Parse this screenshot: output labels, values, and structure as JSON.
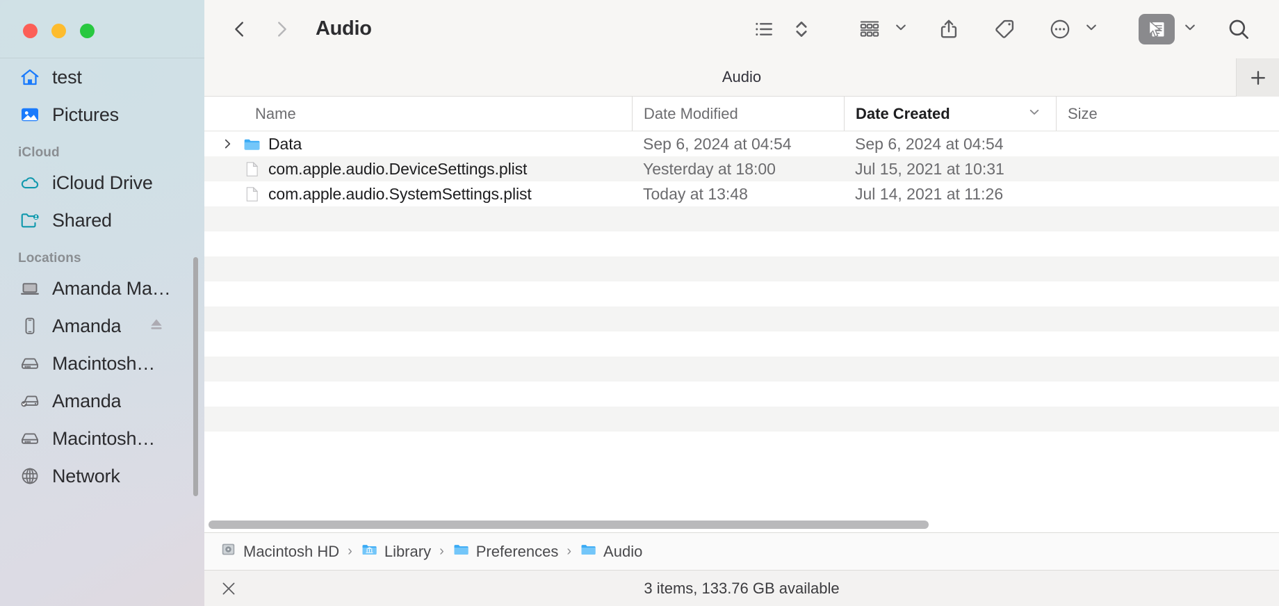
{
  "window": {
    "title": "Audio",
    "subtitle": "Audio",
    "traffic_lights": [
      {
        "name": "close",
        "color": "#fc5f57"
      },
      {
        "name": "minimize",
        "color": "#fdbc2e"
      },
      {
        "name": "zoom",
        "color": "#28c840"
      }
    ]
  },
  "toolbar": {
    "back_label": "Back",
    "forward_label": "Forward",
    "items": [
      {
        "name": "list-view-icon",
        "label": "List View"
      },
      {
        "name": "sort-icon",
        "label": "Sort"
      },
      {
        "name": "group-view-icon",
        "label": "Group"
      },
      {
        "name": "share-icon",
        "label": "Share"
      },
      {
        "name": "tag-icon",
        "label": "Tags"
      },
      {
        "name": "more-icon",
        "label": "More"
      },
      {
        "name": "quick-actions-icon",
        "label": "Quick Actions"
      },
      {
        "name": "search-icon",
        "label": "Search"
      }
    ],
    "add_tab_label": "+"
  },
  "sidebar": {
    "favorites": [
      {
        "label": "test",
        "icon": "home-icon",
        "color": "#1a7bfc"
      },
      {
        "label": "Pictures",
        "icon": "pictures-icon",
        "color": "#1a7bfc"
      }
    ],
    "icloud_title": "iCloud",
    "icloud": [
      {
        "label": "iCloud Drive",
        "icon": "cloud-icon",
        "color": "#1098ad"
      },
      {
        "label": "Shared",
        "icon": "shared-folder-icon",
        "color": "#1098ad"
      }
    ],
    "locations_title": "Locations",
    "locations": [
      {
        "label": "Amanda Ma…",
        "icon": "laptop-icon",
        "eject": false
      },
      {
        "label": "Amanda",
        "icon": "iphone-icon",
        "eject": true
      },
      {
        "label": "Macintosh…",
        "icon": "harddisk-icon",
        "eject": false
      },
      {
        "label": "Amanda",
        "icon": "external-disk-checked-icon",
        "eject": false
      },
      {
        "label": "Macintosh…",
        "icon": "harddisk-icon",
        "eject": false
      },
      {
        "label": "Network",
        "icon": "globe-icon",
        "eject": false
      }
    ]
  },
  "columns": [
    {
      "key": "name",
      "label": "Name",
      "sorted": false
    },
    {
      "key": "date_modified",
      "label": "Date Modified",
      "sorted": false
    },
    {
      "key": "date_created",
      "label": "Date Created",
      "sorted": true
    },
    {
      "key": "size",
      "label": "Size",
      "sorted": false
    }
  ],
  "files": [
    {
      "name": "Data",
      "kind": "folder",
      "expandable": true,
      "date_modified": "Sep 6, 2024 at 04:54",
      "date_created": "Sep 6, 2024 at 04:54",
      "size": ""
    },
    {
      "name": "com.apple.audio.DeviceSettings.plist",
      "kind": "file",
      "expandable": false,
      "date_modified": "Yesterday at 18:00",
      "date_created": "Jul 15, 2021 at 10:31",
      "size": ""
    },
    {
      "name": "com.apple.audio.SystemSettings.plist",
      "kind": "file",
      "expandable": false,
      "date_modified": "Today at 13:48",
      "date_created": "Jul 14, 2021 at 11:26",
      "size": ""
    }
  ],
  "path_bar": {
    "crumbs": [
      {
        "label": "Macintosh HD",
        "icon": "harddisk-icon"
      },
      {
        "label": "Library",
        "icon": "library-folder-icon"
      },
      {
        "label": "Preferences",
        "icon": "folder-icon"
      },
      {
        "label": "Audio",
        "icon": "folder-icon"
      }
    ],
    "separator": "›"
  },
  "status_bar": {
    "text": "3 items, 133.76 GB available"
  }
}
